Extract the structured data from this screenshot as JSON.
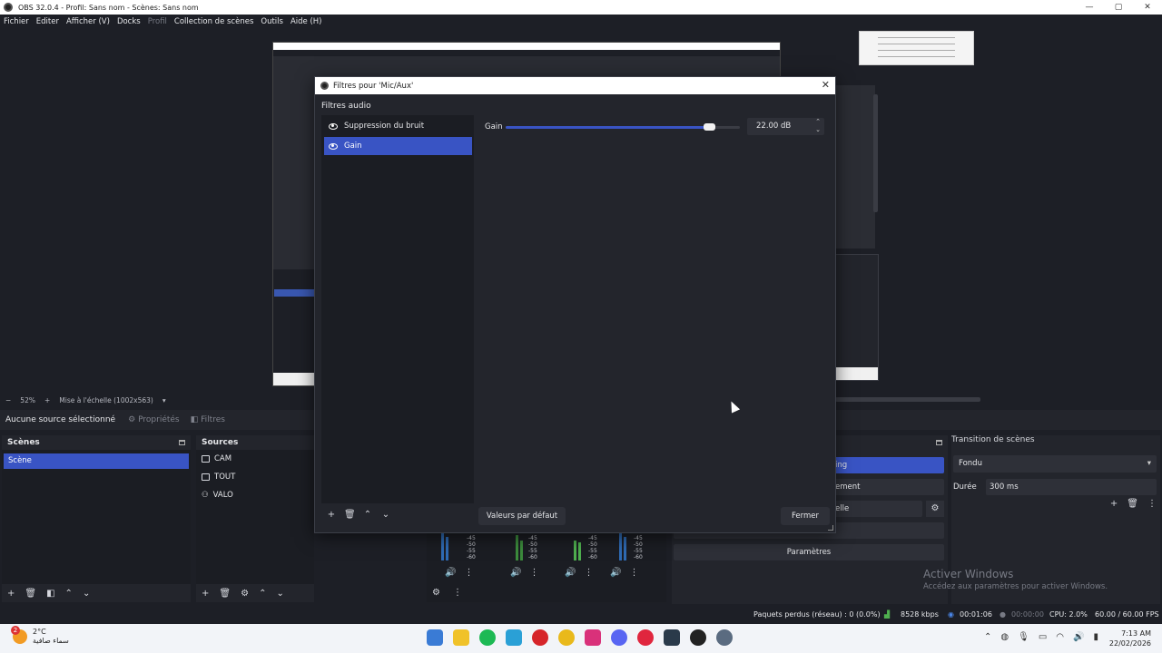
{
  "window": {
    "title": "OBS 32.0.4 - Profil: Sans nom - Scènes: Sans nom",
    "minimize": "—",
    "maximize": "▢",
    "close": "✕"
  },
  "menu": [
    "Fichier",
    "Editer",
    "Afficher (V)",
    "Docks",
    "Profil",
    "Collection de scènes",
    "Outils",
    "Aide (H)"
  ],
  "zoom": {
    "minus": "−",
    "value": "52%",
    "plus": "+",
    "scale_mode": "Mise à l'échelle (1002x563)",
    "arrow": "▾"
  },
  "context": {
    "no_source": "Aucune source sélectionné",
    "properties": "Propriétés",
    "filters": "Filtres"
  },
  "scenes": {
    "title": "Scènes",
    "items": [
      "Scène"
    ]
  },
  "sources": {
    "title": "Sources",
    "items": [
      "CAM",
      "TOUT",
      "VALO"
    ]
  },
  "mixer": {
    "db_scale": [
      "-45",
      "-50",
      "-55",
      "-60"
    ],
    "level": 0.22
  },
  "controls": {
    "btn1": "ing",
    "btn2": "ement",
    "btn3": "elle",
    "settings": "Paramètres"
  },
  "transitions": {
    "title": "Transition de scènes",
    "selected": "Fondu",
    "duration_label": "Durée",
    "duration": "300 ms"
  },
  "watermark": {
    "title": "Activer Windows",
    "subtitle": "Accédez aux paramètres pour activer Windows."
  },
  "status": {
    "dropped": "Paquets perdus (réseau) : 0 (0.0%)",
    "bitrate": "8528 kbps",
    "stream_time": "00:01:06",
    "rec_time": "00:00:00",
    "cpu": "CPU: 2.0%",
    "fps": "60.00 / 60.00 FPS"
  },
  "taskbar": {
    "temp": "2°C",
    "weather_desc": "سماء صافية",
    "weather_badge": "2",
    "time": "7:13 AM",
    "date": "22/02/2026"
  },
  "dialog": {
    "title": "Filtres pour 'Mic/Aux'",
    "close": "✕",
    "section": "Filtres audio",
    "filters": [
      {
        "name": "Suppression du bruit",
        "selected": false
      },
      {
        "name": "Gain",
        "selected": true
      }
    ],
    "gain_label": "Gain",
    "gain_value": "22.00 dB",
    "gain_range": [
      -30,
      30
    ],
    "gain_numeric": 22.0,
    "defaults_button": "Valeurs par défaut",
    "close_button": "Fermer"
  },
  "colors": {
    "accent": "#3954c4",
    "bg": "#1d1f26",
    "panel": "#23252c"
  }
}
